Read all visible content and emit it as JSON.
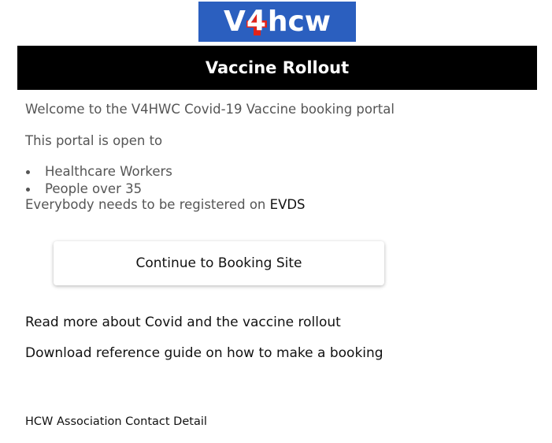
{
  "logo": {
    "text_left": "V",
    "text_number": "4",
    "text_right": "hcw",
    "background_color": "#2b5fbf",
    "cross_color": "#e2231a"
  },
  "header": {
    "title": "Vaccine Rollout"
  },
  "intro": {
    "welcome": "Welcome to the V4HWC Covid-19 Vaccine booking portal",
    "open_to": "This portal is open to",
    "audience": [
      "Healthcare Workers",
      "People over 35"
    ],
    "registration_prefix": "Everybody needs to be registered on ",
    "registration_link": "EVDS"
  },
  "actions": {
    "booking_button": "Continue to Booking Site"
  },
  "links": {
    "read_more": "Read more about Covid and the vaccine rollout",
    "download_guide": "Download reference guide on how to make a booking"
  },
  "footer": {
    "contact": "HCW Association Contact Detail"
  }
}
